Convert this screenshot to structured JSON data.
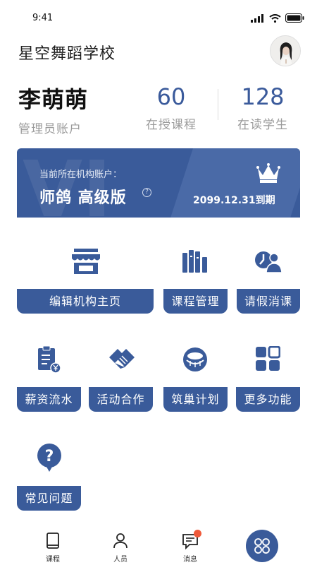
{
  "status_bar": {
    "time": "9:41"
  },
  "header": {
    "title": "星空舞蹈学校"
  },
  "user": {
    "name": "李萌萌",
    "role": "管理员账户"
  },
  "stats": [
    {
      "value": "60",
      "label": "在授课程"
    },
    {
      "value": "128",
      "label": "在读学生"
    }
  ],
  "banner": {
    "subtitle": "当前所在机构账户：",
    "plan": "师鸽 高级版",
    "expire": "2099.12.31到期",
    "watermark": "VI",
    "help_glyph": "?"
  },
  "features": [
    {
      "label": "编辑机构主页",
      "icon": "store-icon"
    },
    {
      "label": "课程管理",
      "icon": "books-icon"
    },
    {
      "label": "请假消课",
      "icon": "leave-icon"
    },
    {
      "label": "薪资流水",
      "icon": "salary-icon"
    },
    {
      "label": "活动合作",
      "icon": "handshake-icon"
    },
    {
      "label": "筑巢计划",
      "icon": "nest-icon"
    },
    {
      "label": "更多功能",
      "icon": "grid-icon"
    },
    {
      "label": "常见问题",
      "icon": "question-icon"
    }
  ],
  "tabbar": {
    "items": [
      {
        "label": "课程",
        "icon": "book-icon"
      },
      {
        "label": "人员",
        "icon": "person-icon"
      },
      {
        "label": "消息",
        "icon": "message-icon"
      }
    ]
  },
  "colors": {
    "primary": "#3a5b9a",
    "accent": "#f05a3a",
    "muted": "#9a9a9a"
  }
}
